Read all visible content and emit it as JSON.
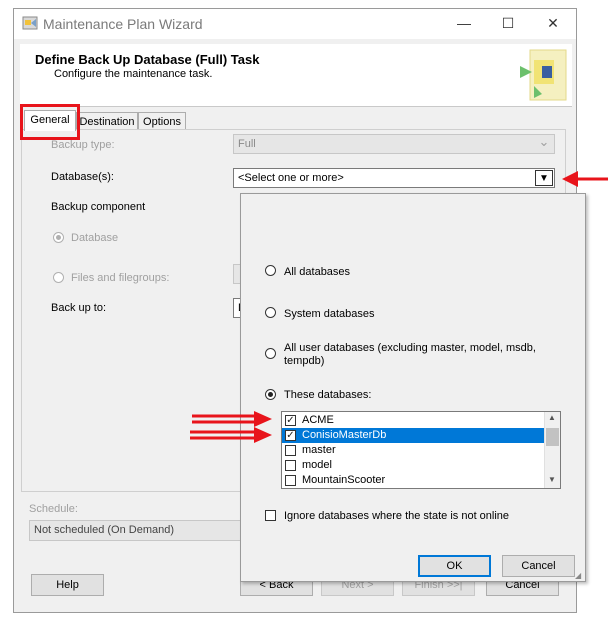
{
  "window": {
    "title": "Maintenance Plan Wizard",
    "minimize_icon": "minimize-icon",
    "maximize_icon": "maximize-icon",
    "close_icon": "close-icon",
    "minimize_glyph": "—",
    "maximize_glyph": "☐",
    "close_glyph": "✕"
  },
  "header": {
    "title": "Define Back Up Database (Full) Task",
    "subtitle": "Configure the maintenance task."
  },
  "tabs": [
    {
      "label": "General",
      "active": true
    },
    {
      "label": "Destination",
      "active": false
    },
    {
      "label": "Options",
      "active": false
    }
  ],
  "form": {
    "backup_type_label": "Backup type:",
    "backup_type_value": "Full",
    "databases_label": "Database(s):",
    "databases_value": "<Select one or more>",
    "backup_component_label": "Backup component",
    "component_database": "Database",
    "component_files": "Files and filegroups:",
    "back_up_to_label": "Back up to:",
    "back_up_to_value": "D",
    "dropdown_glyph": "▼",
    "chevron_glyph": "⌄"
  },
  "schedule": {
    "label": "Schedule:",
    "value": "Not scheduled (On Demand)"
  },
  "footer": {
    "help": "Help",
    "back": "< Back",
    "next": "Next >",
    "finish": "Finish >>|",
    "cancel": "Cancel"
  },
  "dropdown": {
    "options": [
      {
        "label": "All databases",
        "checked": false
      },
      {
        "label": "System databases",
        "checked": false
      },
      {
        "label": "All user databases  (excluding master, model, msdb, tempdb)",
        "checked": false
      },
      {
        "label": "These databases:",
        "checked": true
      }
    ],
    "databases": [
      {
        "name": "ACME",
        "checked": true,
        "selected": false
      },
      {
        "name": "ConisioMasterDb",
        "checked": true,
        "selected": true
      },
      {
        "name": "master",
        "checked": false,
        "selected": false
      },
      {
        "name": "model",
        "checked": false,
        "selected": false
      },
      {
        "name": "MountainScooter",
        "checked": false,
        "selected": false
      }
    ],
    "ignore_offline": "Ignore databases where the state is not online",
    "ok": "OK",
    "cancel": "Cancel",
    "check_glyph": "✓",
    "scroll_up_glyph": "▲",
    "scroll_down_glyph": "▼",
    "resize_glyph": "◢"
  },
  "annotations": {
    "color": "#e8141b"
  }
}
